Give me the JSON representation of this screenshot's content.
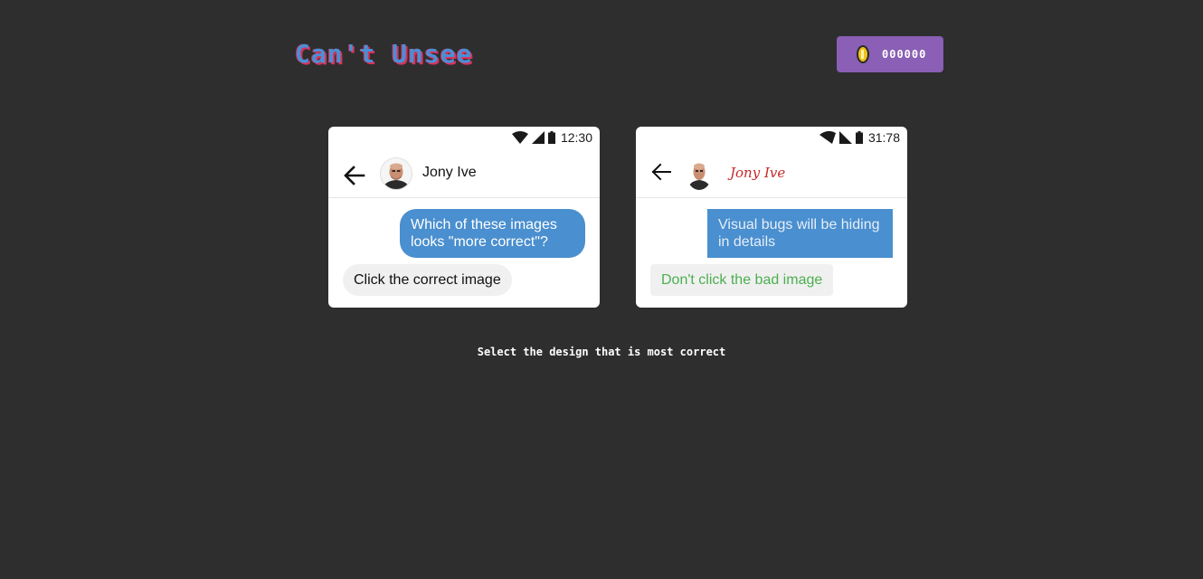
{
  "app": {
    "logo_text": "Can't Unsee",
    "coins": "000000"
  },
  "instruction": "Select the design that is most correct",
  "options": [
    {
      "status_time": "12:30",
      "contact_name": "Jony Ive",
      "outgoing_message": "Which of these images looks \"more correct\"?",
      "incoming_message": "Click the correct image"
    },
    {
      "status_time": "31:78",
      "contact_name": "Jony Ive",
      "outgoing_message": "Visual bugs will be hiding in details",
      "incoming_message": "Don't click the bad image"
    }
  ],
  "colors": {
    "background": "#2e2e2e",
    "coin_box": "#8a5fb5",
    "logo_blue": "#4a8fd6",
    "logo_red": "#d8325a",
    "bubble_blue": "#4a8fcf",
    "bug_name_red": "#c62828",
    "bug_text_green": "#4caf50"
  },
  "icons": [
    "coin-icon",
    "wifi-icon",
    "signal-icon",
    "battery-icon",
    "back-arrow-icon",
    "avatar"
  ]
}
